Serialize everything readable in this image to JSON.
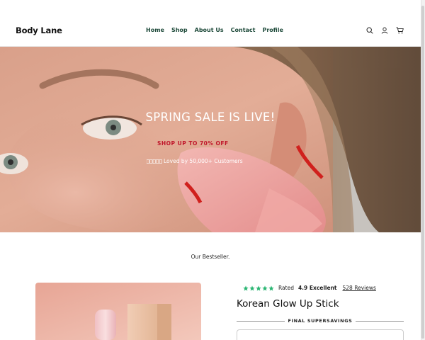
{
  "header": {
    "logo": "Body Lane",
    "nav": [
      "Home",
      "Shop",
      "About Us",
      "Contact",
      "Profile"
    ],
    "icons": [
      "search-icon",
      "account-icon",
      "cart-icon"
    ]
  },
  "hero": {
    "title": "SPRING SALE IS LIVE!",
    "subtitle": "SHOP UP TO 70% OFF",
    "loved_text": "Loved by 50,000+ Customers"
  },
  "section": {
    "heading": "Our Bestseller."
  },
  "product": {
    "rating_label": "Rated",
    "rating_value": "4.9 Excellent",
    "reviews": "528 Reviews",
    "stars": 5,
    "title": "Korean Glow Up Stick",
    "savings_label": "FINAL SUPERSAVINGS"
  },
  "colors": {
    "nav": "#1f4b3b",
    "sale_red": "#c0172b",
    "star_green": "#2bb673"
  }
}
